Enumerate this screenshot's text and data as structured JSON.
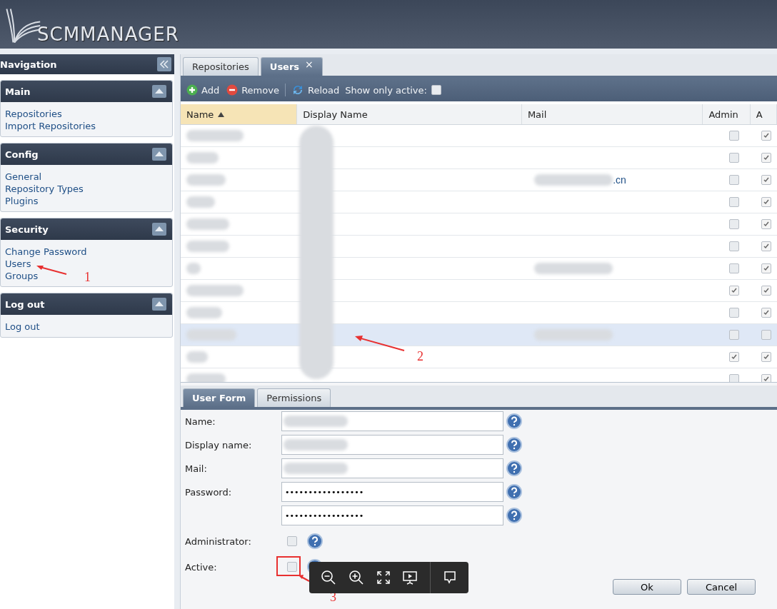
{
  "header": {
    "logo_text": "SCMMANAGER"
  },
  "navigation": {
    "title": "Navigation",
    "sections": [
      {
        "title": "Main",
        "links": [
          "Repositories",
          "Import Repositories"
        ]
      },
      {
        "title": "Config",
        "links": [
          "General",
          "Repository Types",
          "Plugins"
        ]
      },
      {
        "title": "Security",
        "links": [
          "Change Password",
          "Users",
          "Groups"
        ]
      },
      {
        "title": "Log out",
        "links": [
          "Log out"
        ]
      }
    ]
  },
  "tabs": [
    {
      "label": "Repositories",
      "selected": false,
      "closable": false
    },
    {
      "label": "Users",
      "selected": true,
      "closable": true,
      "close_glyph": "×"
    }
  ],
  "toolbar": {
    "buttons": [
      {
        "label": "Add",
        "kind": "add"
      },
      {
        "label": "Remove",
        "kind": "remove"
      },
      {
        "label": "Reload",
        "kind": "reload"
      }
    ],
    "filter": {
      "label": "Show only active:",
      "checked": false
    }
  },
  "table": {
    "columns": [
      {
        "label": "Name",
        "sorted": true
      },
      {
        "label": "Display Name",
        "sorted": false
      },
      {
        "label": "Mail",
        "sorted": false
      },
      {
        "label": "Admin",
        "sorted": false
      },
      {
        "label": "A",
        "sorted": false
      }
    ],
    "rows": [
      {
        "mail_redacted": false,
        "admin": false,
        "active": true,
        "selected": false
      },
      {
        "mail_redacted": false,
        "admin": false,
        "active": true,
        "selected": false
      },
      {
        "mail": ".cn",
        "mail_redacted": true,
        "admin": false,
        "active": true,
        "selected": false
      },
      {
        "mail_redacted": false,
        "admin": false,
        "active": true,
        "selected": false
      },
      {
        "mail_redacted": false,
        "admin": false,
        "active": true,
        "selected": false
      },
      {
        "mail_redacted": false,
        "admin": false,
        "active": true,
        "selected": false
      },
      {
        "mail_redacted": true,
        "admin": false,
        "active": true,
        "selected": false
      },
      {
        "mail_redacted": false,
        "admin": true,
        "active": true,
        "selected": false
      },
      {
        "mail_redacted": false,
        "admin": false,
        "active": true,
        "selected": false
      },
      {
        "mail_redacted": true,
        "admin": false,
        "active": false,
        "selected": true
      },
      {
        "mail_redacted": false,
        "admin": true,
        "active": true,
        "selected": false
      },
      {
        "mail_redacted": false,
        "admin": false,
        "active": true,
        "selected": false
      }
    ]
  },
  "form": {
    "tabs": [
      {
        "label": "User Form",
        "selected": true
      },
      {
        "label": "Permissions",
        "selected": false
      }
    ],
    "fields": [
      {
        "kind": "text",
        "label": "Name:",
        "redacted": true
      },
      {
        "kind": "text",
        "label": "Display name:",
        "redacted": true
      },
      {
        "kind": "text",
        "label": "Mail:",
        "redacted": true
      },
      {
        "kind": "password",
        "label": "Password:",
        "value": "•••••••••••••••••"
      },
      {
        "kind": "password",
        "value": "•••••••••••••••••"
      },
      {
        "kind": "checkbox",
        "label": "Administrator:",
        "checked": false
      },
      {
        "kind": "checkbox",
        "label": "Active:",
        "checked": false,
        "highlighted": true
      }
    ],
    "buttons": [
      "Ok",
      "Cancel"
    ]
  },
  "annotations": [
    {
      "text": "1"
    },
    {
      "text": "2"
    },
    {
      "text": "3"
    }
  ]
}
